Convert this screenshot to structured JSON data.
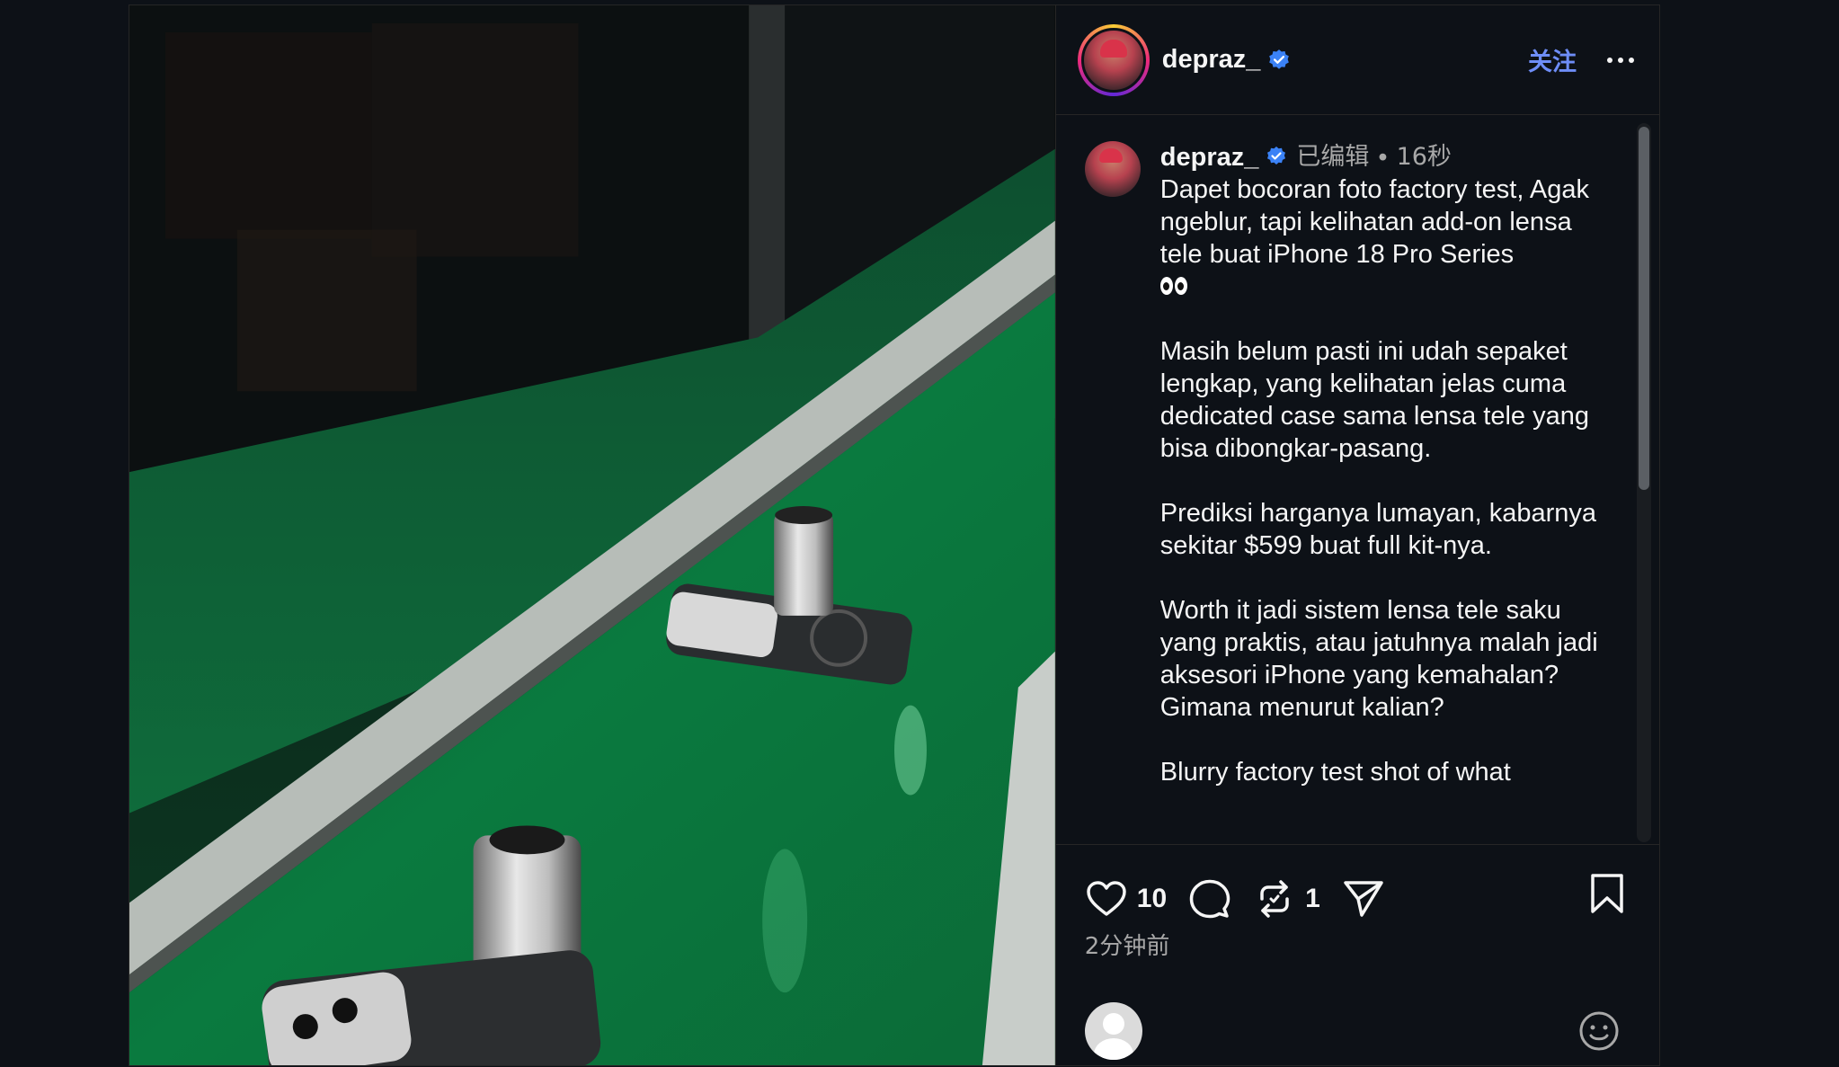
{
  "header": {
    "username": "depraz_",
    "verified_icon": "verified-badge-icon",
    "follow_label": "关注",
    "more_icon": "more-options-icon"
  },
  "caption": {
    "username": "depraz_",
    "edited_label": "已编辑",
    "separator": "•",
    "time": "16秒",
    "paragraphs": [
      "Dapet bocoran foto factory test, Agak ngeblur, tapi kelihatan add-on lensa tele buat iPhone 18 Pro Series",
      "Masih belum pasti ini udah sepaket lengkap, yang kelihatan jelas cuma dedicated case sama lensa tele yang bisa dibongkar-pasang.",
      "Prediksi harganya lumayan, kabarnya sekitar $599 buat full kit-nya.",
      "Worth it jadi sistem lensa tele saku yang praktis, atau jatuhnya malah jadi aksesori iPhone yang kemahalan? Gimana menurut kalian?",
      "Blurry factory test shot of what"
    ],
    "emoji": "👀"
  },
  "actions": {
    "like_count": "10",
    "repost_count": "1",
    "posted_time": "2分钟前",
    "icons": [
      "heart-icon",
      "comment-icon",
      "repost-icon",
      "share-icon",
      "bookmark-icon"
    ]
  },
  "comment": {
    "placeholder": "",
    "emoji_icon": "emoji-icon"
  },
  "colors": {
    "accent": "#6e8df7",
    "background": "#0d1117",
    "verified": "#3b82f6"
  }
}
